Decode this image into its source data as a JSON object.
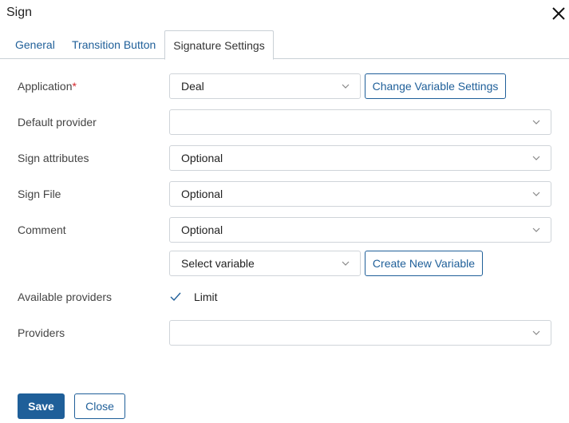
{
  "dialog": {
    "title": "Sign"
  },
  "tabs": [
    {
      "label": "General"
    },
    {
      "label": "Transition Button"
    },
    {
      "label": "Signature Settings"
    }
  ],
  "form": {
    "application": {
      "label": "Application",
      "required_mark": "*",
      "value": "Deal",
      "button": "Change Variable Settings"
    },
    "default_provider": {
      "label": "Default provider",
      "value": ""
    },
    "sign_attributes": {
      "label": "Sign attributes",
      "value": "Optional"
    },
    "sign_file": {
      "label": "Sign File",
      "value": "Optional"
    },
    "comment": {
      "label": "Comment",
      "value": "Optional"
    },
    "variable": {
      "value": "Select variable",
      "button": "Create New Variable"
    },
    "available_providers": {
      "label": "Available providers",
      "checkbox_label": "Limit",
      "checked": true
    },
    "providers": {
      "label": "Providers",
      "value": ""
    }
  },
  "footer": {
    "save_label": "Save",
    "close_label": "Close"
  },
  "colors": {
    "accent": "#1f5f99",
    "required": "#d4262c",
    "border": "#cfd4d9"
  }
}
